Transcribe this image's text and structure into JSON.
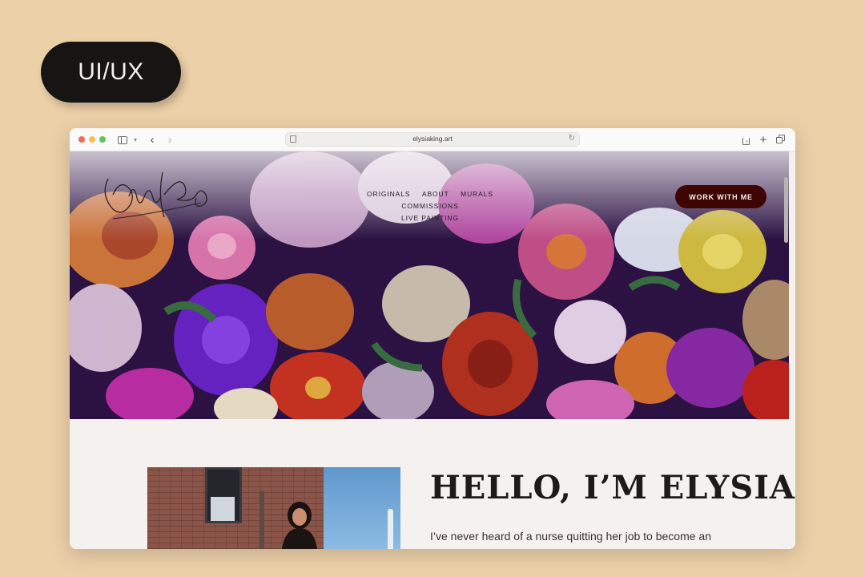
{
  "badge": {
    "label": "UI/UX"
  },
  "browser": {
    "url": "elysiaking.art",
    "toolbar_icons": [
      "sidebar-icon",
      "chevron-down-icon",
      "back-arrow-icon",
      "forward-arrow-icon",
      "page-icon",
      "reload-icon",
      "share-icon",
      "new-tab-icon",
      "tab-overview-icon"
    ],
    "traffic_light_colors": [
      "#ee6a5e",
      "#f5bf4f",
      "#62c554"
    ]
  },
  "site": {
    "logo_text": "Elysia King",
    "nav": [
      {
        "label": "ORIGINALS"
      },
      {
        "label": "ABOUT"
      },
      {
        "label": "MURALS"
      },
      {
        "label": "COMMISSIONS"
      },
      {
        "label": "LIVE PAINTING"
      }
    ],
    "cta_label": "WORK WITH ME",
    "cta_color": "#3e0505",
    "hello_heading": "HELLO, I’M ELYSIA",
    "intro_line": "I’ve never heard of a nurse quitting her job to become an"
  }
}
